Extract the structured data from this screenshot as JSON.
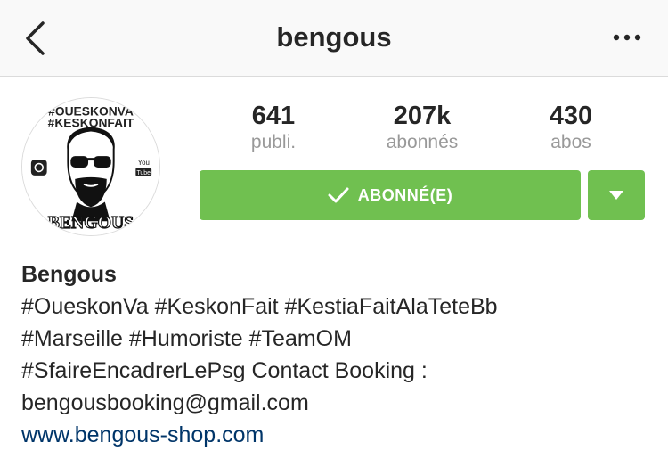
{
  "header": {
    "username": "bengous",
    "back_icon": "chevron-left-icon",
    "more_icon": "more-horizontal-icon"
  },
  "profile": {
    "avatar_text_top_1": "#OUESKONVA",
    "avatar_text_top_2": "#KESKONFAIT",
    "avatar_text_bottom": "BENGOUS",
    "avatar_badge_you": "You",
    "avatar_badge_tube": "Tube"
  },
  "stats": {
    "posts": {
      "value": "641",
      "label": "publi."
    },
    "followers": {
      "value": "207k",
      "label": "abonnés"
    },
    "following": {
      "value": "430",
      "label": "abos"
    }
  },
  "actions": {
    "follow_label": "ABONNÉ(E)",
    "follow_icon": "checkmark-icon",
    "dropdown_icon": "caret-down-icon",
    "button_color": "#70c050"
  },
  "bio": {
    "name": "Bengous",
    "lines": [
      "#OueskonVa #KeskonFait #KestiaFaitAlaTeteBb",
      "#Marseille #Humoriste #TeamOM",
      "#SfaireEncadrerLePsg Contact Booking :",
      "bengousbooking@gmail.com"
    ],
    "link": "www.bengous-shop.com",
    "link_color": "#003569"
  }
}
